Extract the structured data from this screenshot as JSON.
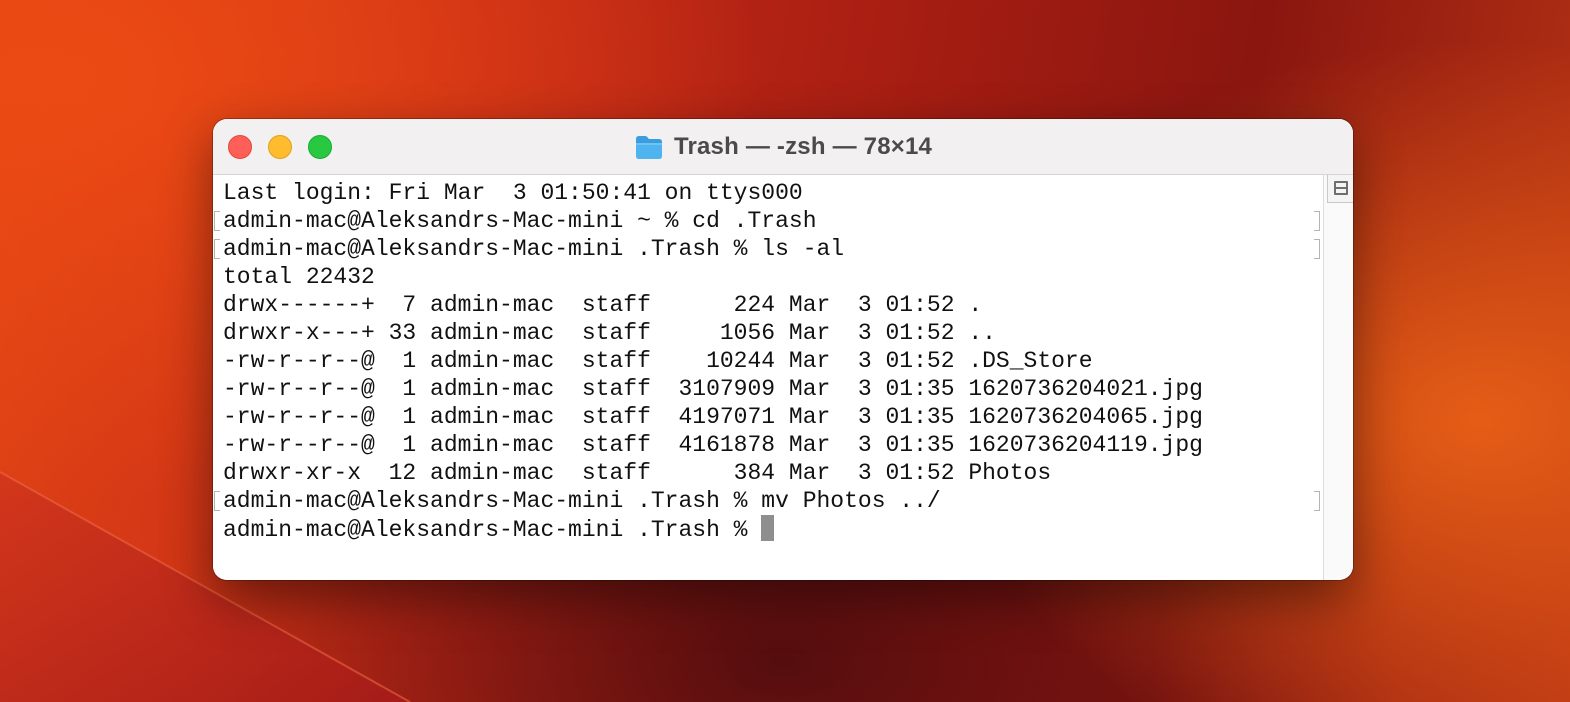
{
  "window": {
    "title": "Trash — -zsh — 78×14"
  },
  "icons": {
    "title_icon": "folder-icon",
    "split_pane": "split-pane-icon",
    "folder_color": "#4fb3ef"
  },
  "colors": {
    "traffic_close": "#fe5f57",
    "traffic_minimize": "#febc2e",
    "traffic_zoom": "#28c840"
  },
  "terminal": {
    "login_line": "Last login: Fri Mar  3 01:50:41 on ttys000",
    "commands": [
      "admin-mac@Aleksandrs-Mac-mini ~ % cd .Trash",
      "admin-mac@Aleksandrs-Mac-mini .Trash % ls -al"
    ],
    "total_line": "total 22432",
    "listing": [
      "drwx------+  7 admin-mac  staff      224 Mar  3 01:52 .",
      "drwxr-x---+ 33 admin-mac  staff     1056 Mar  3 01:52 ..",
      "-rw-r--r--@  1 admin-mac  staff    10244 Mar  3 01:52 .DS_Store",
      "-rw-r--r--@  1 admin-mac  staff  3107909 Mar  3 01:35 1620736204021.jpg",
      "-rw-r--r--@  1 admin-mac  staff  4197071 Mar  3 01:35 1620736204065.jpg",
      "-rw-r--r--@  1 admin-mac  staff  4161878 Mar  3 01:35 1620736204119.jpg",
      "drwxr-xr-x  12 admin-mac  staff      384 Mar  3 01:52 Photos"
    ],
    "mv_command": "admin-mac@Aleksandrs-Mac-mini .Trash % mv Photos ../",
    "prompt": "admin-mac@Aleksandrs-Mac-mini .Trash % "
  }
}
